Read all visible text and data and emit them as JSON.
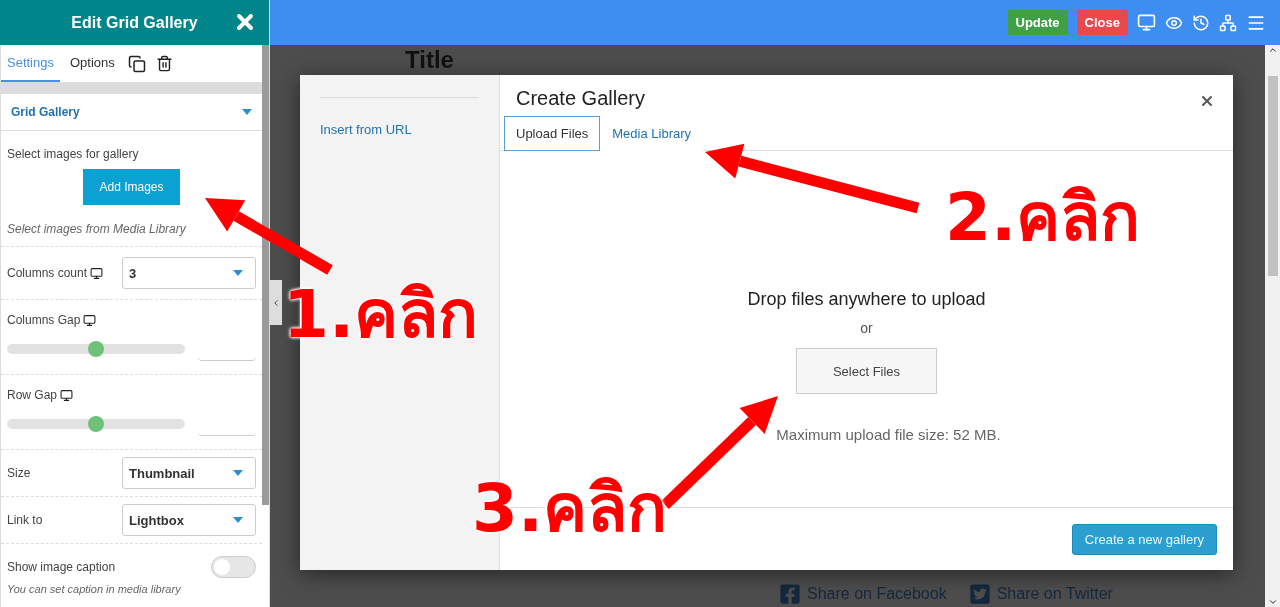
{
  "sidebar": {
    "title": "Edit Grid Gallery",
    "tabs": [
      {
        "label": "Settings",
        "selected": true
      },
      {
        "label": "Options",
        "selected": false
      }
    ],
    "section": "Grid Gallery",
    "gallery": {
      "label": "Select images for gallery",
      "button": "Add Images",
      "hint": "Select images from Media Library"
    },
    "controls": [
      {
        "kind": "select",
        "label": "Columns count",
        "device": true,
        "value": "3"
      },
      {
        "kind": "slider",
        "label": "Columns Gap",
        "device": true,
        "level": 0.5
      },
      {
        "kind": "slider",
        "label": "Row Gap",
        "device": true,
        "level": 0.5
      },
      {
        "kind": "select",
        "label": "Size",
        "device": false,
        "value": "Thumbnail"
      },
      {
        "kind": "select",
        "label": "Link to",
        "device": false,
        "value": "Lightbox"
      },
      {
        "kind": "toggle",
        "label": "Show image caption",
        "device": false,
        "on": false,
        "note": "You can set caption in media library"
      }
    ]
  },
  "toolbar": {
    "buttons": [
      {
        "label": "Update",
        "kind": "save"
      },
      {
        "label": "Close",
        "kind": "close"
      }
    ]
  },
  "page": {
    "title": "Title",
    "share": [
      "Share on Facebook",
      "Share on Twitter"
    ]
  },
  "modal": {
    "sidebar_link": "Insert from URL",
    "title": "Create Gallery",
    "tabs": [
      {
        "label": "Upload Files",
        "selected": true
      },
      {
        "label": "Media Library",
        "selected": false
      }
    ],
    "drop_text": "Drop files anywhere to upload",
    "or": "or",
    "select_button": "Select Files",
    "max_size": "Maximum upload file size: 52 MB.",
    "create_button": "Create a new gallery"
  },
  "annotations": [
    {
      "text": "1.คลิก"
    },
    {
      "text": "2.คลิก"
    },
    {
      "text": "3.คลิก"
    }
  ]
}
